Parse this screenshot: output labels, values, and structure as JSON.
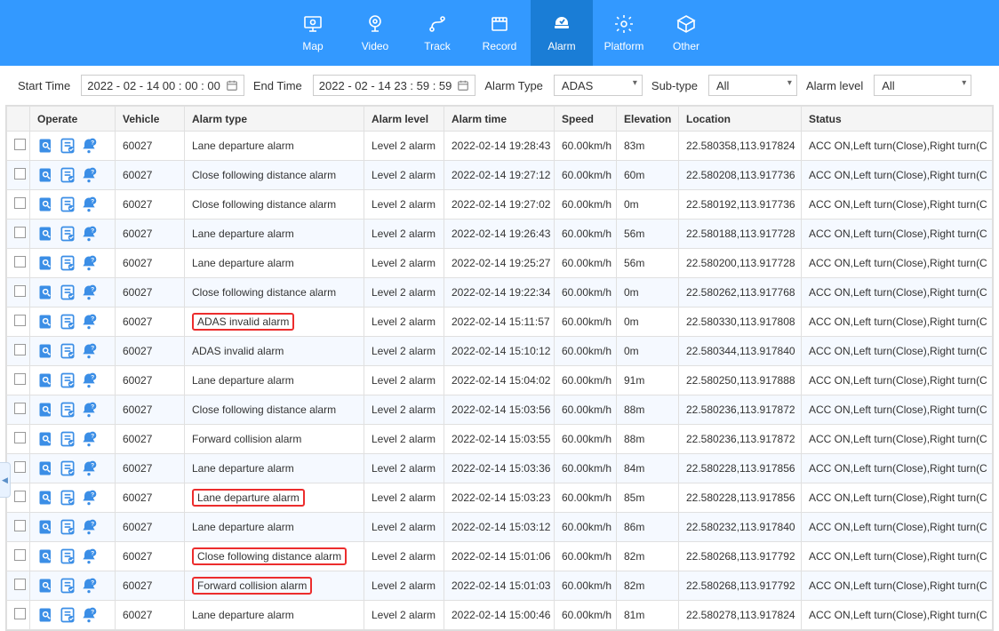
{
  "nav": {
    "items": [
      {
        "label": "Map"
      },
      {
        "label": "Video"
      },
      {
        "label": "Track"
      },
      {
        "label": "Record"
      },
      {
        "label": "Alarm"
      },
      {
        "label": "Platform"
      },
      {
        "label": "Other"
      }
    ]
  },
  "filters": {
    "start_label": "Start Time",
    "start_value": "2022 - 02 - 14  00 : 00 : 00",
    "end_label": "End Time",
    "end_value": "2022 - 02 - 14  23 : 59 : 59",
    "alarm_type_label": "Alarm Type",
    "alarm_type_value": "ADAS",
    "sub_type_label": "Sub-type",
    "sub_type_value": "All",
    "alarm_level_label": "Alarm level",
    "alarm_level_value": "All"
  },
  "table": {
    "headers": {
      "operate": "Operate",
      "vehicle": "Vehicle",
      "alarm_type": "Alarm type",
      "alarm_level": "Alarm level",
      "alarm_time": "Alarm time",
      "speed": "Speed",
      "elevation": "Elevation",
      "location": "Location",
      "status": "Status"
    },
    "status_text": "ACC ON,Left turn(Close),Right turn(C",
    "rows": [
      {
        "vehicle": "60027",
        "type": "Lane departure alarm",
        "level": "Level 2 alarm",
        "time": "2022-02-14 19:28:43",
        "speed": "60.00km/h",
        "elev": "83m",
        "loc": "22.580358,113.917824",
        "hl": false
      },
      {
        "vehicle": "60027",
        "type": "Close following distance alarm",
        "level": "Level 2 alarm",
        "time": "2022-02-14 19:27:12",
        "speed": "60.00km/h",
        "elev": "60m",
        "loc": "22.580208,113.917736",
        "hl": false
      },
      {
        "vehicle": "60027",
        "type": "Close following distance alarm",
        "level": "Level 2 alarm",
        "time": "2022-02-14 19:27:02",
        "speed": "60.00km/h",
        "elev": "0m",
        "loc": "22.580192,113.917736",
        "hl": false
      },
      {
        "vehicle": "60027",
        "type": "Lane departure alarm",
        "level": "Level 2 alarm",
        "time": "2022-02-14 19:26:43",
        "speed": "60.00km/h",
        "elev": "56m",
        "loc": "22.580188,113.917728",
        "hl": false
      },
      {
        "vehicle": "60027",
        "type": "Lane departure alarm",
        "level": "Level 2 alarm",
        "time": "2022-02-14 19:25:27",
        "speed": "60.00km/h",
        "elev": "56m",
        "loc": "22.580200,113.917728",
        "hl": false
      },
      {
        "vehicle": "60027",
        "type": "Close following distance alarm",
        "level": "Level 2 alarm",
        "time": "2022-02-14 19:22:34",
        "speed": "60.00km/h",
        "elev": "0m",
        "loc": "22.580262,113.917768",
        "hl": false
      },
      {
        "vehicle": "60027",
        "type": "ADAS invalid alarm",
        "level": "Level 2 alarm",
        "time": "2022-02-14 15:11:57",
        "speed": "60.00km/h",
        "elev": "0m",
        "loc": "22.580330,113.917808",
        "hl": true
      },
      {
        "vehicle": "60027",
        "type": "ADAS invalid alarm",
        "level": "Level 2 alarm",
        "time": "2022-02-14 15:10:12",
        "speed": "60.00km/h",
        "elev": "0m",
        "loc": "22.580344,113.917840",
        "hl": false
      },
      {
        "vehicle": "60027",
        "type": "Lane departure alarm",
        "level": "Level 2 alarm",
        "time": "2022-02-14 15:04:02",
        "speed": "60.00km/h",
        "elev": "91m",
        "loc": "22.580250,113.917888",
        "hl": false
      },
      {
        "vehicle": "60027",
        "type": "Close following distance alarm",
        "level": "Level 2 alarm",
        "time": "2022-02-14 15:03:56",
        "speed": "60.00km/h",
        "elev": "88m",
        "loc": "22.580236,113.917872",
        "hl": false
      },
      {
        "vehicle": "60027",
        "type": "Forward collision alarm",
        "level": "Level 2 alarm",
        "time": "2022-02-14 15:03:55",
        "speed": "60.00km/h",
        "elev": "88m",
        "loc": "22.580236,113.917872",
        "hl": false
      },
      {
        "vehicle": "60027",
        "type": "Lane departure alarm",
        "level": "Level 2 alarm",
        "time": "2022-02-14 15:03:36",
        "speed": "60.00km/h",
        "elev": "84m",
        "loc": "22.580228,113.917856",
        "hl": false
      },
      {
        "vehicle": "60027",
        "type": "Lane departure alarm",
        "level": "Level 2 alarm",
        "time": "2022-02-14 15:03:23",
        "speed": "60.00km/h",
        "elev": "85m",
        "loc": "22.580228,113.917856",
        "hl": true
      },
      {
        "vehicle": "60027",
        "type": "Lane departure alarm",
        "level": "Level 2 alarm",
        "time": "2022-02-14 15:03:12",
        "speed": "60.00km/h",
        "elev": "86m",
        "loc": "22.580232,113.917840",
        "hl": false
      },
      {
        "vehicle": "60027",
        "type": "Close following distance alarm",
        "level": "Level 2 alarm",
        "time": "2022-02-14 15:01:06",
        "speed": "60.00km/h",
        "elev": "82m",
        "loc": "22.580268,113.917792",
        "hl": true
      },
      {
        "vehicle": "60027",
        "type": "Forward collision alarm",
        "level": "Level 2 alarm",
        "time": "2022-02-14 15:01:03",
        "speed": "60.00km/h",
        "elev": "82m",
        "loc": "22.580268,113.917792",
        "hl": true
      },
      {
        "vehicle": "60027",
        "type": "Lane departure alarm",
        "level": "Level 2 alarm",
        "time": "2022-02-14 15:00:46",
        "speed": "60.00km/h",
        "elev": "81m",
        "loc": "22.580278,113.917824",
        "hl": false
      }
    ]
  }
}
